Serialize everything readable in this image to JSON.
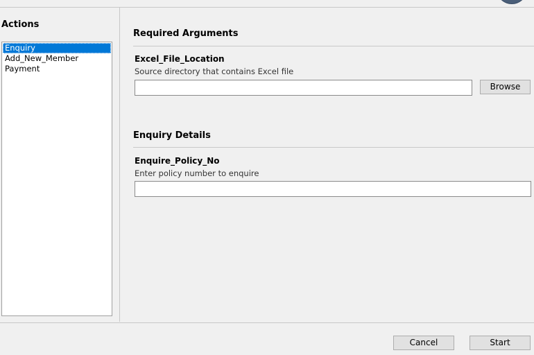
{
  "actions_panel": {
    "title": "Actions",
    "items": [
      {
        "label": "Enquiry",
        "selected": true
      },
      {
        "label": "Add_New_Member",
        "selected": false
      },
      {
        "label": "Payment",
        "selected": false
      }
    ]
  },
  "required_arguments": {
    "title": "Required Arguments",
    "field_label": "Excel_File_Location",
    "field_description": "Source directory that contains Excel file",
    "field_value": "",
    "browse_label": "Browse"
  },
  "enquiry_details": {
    "title": "Enquiry Details",
    "field_label": "Enquire_Policy_No",
    "field_description": "Enter policy number to enquire",
    "field_value": ""
  },
  "footer": {
    "cancel_label": "Cancel",
    "start_label": "Start"
  },
  "colors": {
    "selection": "#0078d7",
    "background": "#f0f0f0"
  }
}
